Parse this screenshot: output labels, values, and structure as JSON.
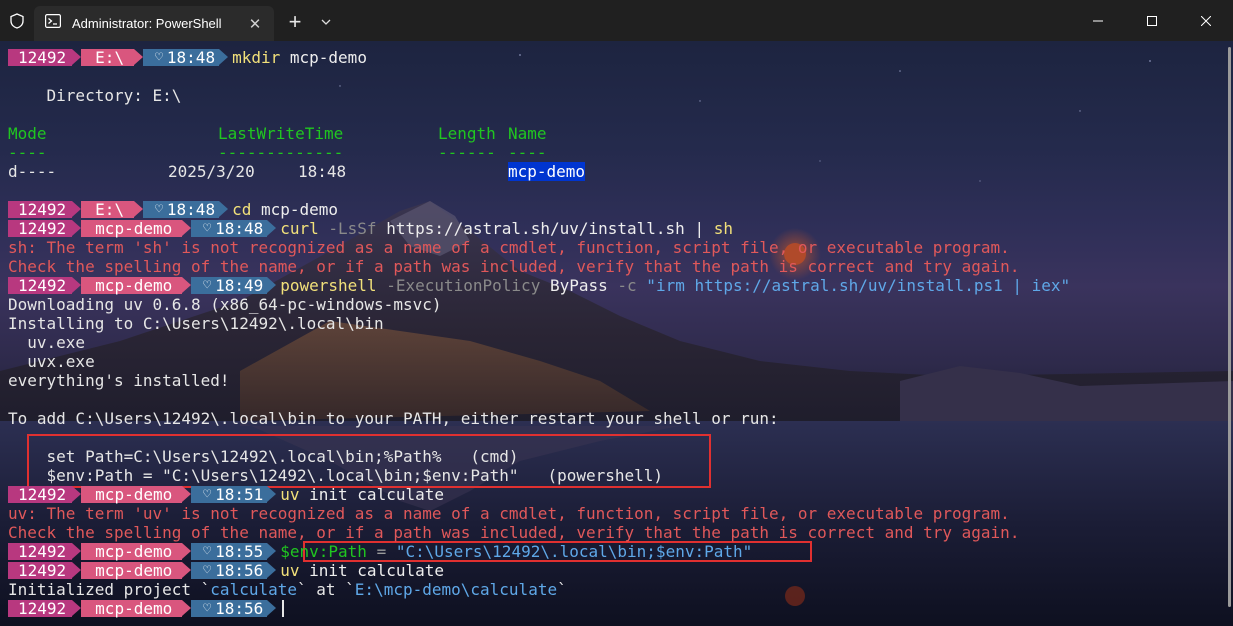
{
  "window": {
    "tab_title": "Administrator: PowerShell",
    "tab_close": "✕",
    "new_tab": "+",
    "dropdown": "⌄"
  },
  "prompt": {
    "id": "12492",
    "heart": "♡"
  },
  "lines": {
    "l1": {
      "dir": "E:\\",
      "time": "18:48",
      "cmd": "mkdir",
      "args": " mcp-demo"
    },
    "l3": "    Directory: E:\\",
    "l5_mode": "Mode",
    "l5_lwt": "LastWriteTime",
    "l5_len": "Length",
    "l5_name": "Name",
    "l6_mode": "----",
    "l6_lwt": "-------------",
    "l6_len": "------",
    "l6_name": "----",
    "l7_mode": "d----",
    "l7_date": "2025/3/20",
    "l7_time": "18:48",
    "l7_name": "mcp-demo",
    "l9": {
      "dir": "E:\\",
      "time": "18:48",
      "cmd": "cd",
      "args": " mcp-demo"
    },
    "l10": {
      "dir": "mcp-demo",
      "time": "18:48",
      "cmd": "curl",
      "param": " -LsSf",
      "args": " https://astral.sh/uv/install.sh | ",
      "cmd2": "sh"
    },
    "l11": "sh: The term 'sh' is not recognized as a name of a cmdlet, function, script file, or executable program.",
    "l12": "Check the spelling of the name, or if a path was included, verify that the path is correct and try again.",
    "l13": {
      "dir": "mcp-demo",
      "time": "18:49",
      "cmd": "powershell",
      "param": " -ExecutionPolicy",
      "arg": " ByPass",
      "param2": " -c",
      "str": " \"irm https://astral.sh/uv/install.ps1 | iex\""
    },
    "l14": "Downloading uv 0.6.8 (x86_64-pc-windows-msvc)",
    "l15": "Installing to C:\\Users\\12492\\.local\\bin",
    "l16": "  uv.exe",
    "l17": "  uvx.exe",
    "l18": "everything's installed!",
    "l20": "To add C:\\Users\\12492\\.local\\bin to your PATH, either restart your shell or run:",
    "l22": "    set Path=C:\\Users\\12492\\.local\\bin;%Path%   (cmd)",
    "l23": "    $env:Path = \"C:\\Users\\12492\\.local\\bin;$env:Path\"   (powershell)",
    "l24": {
      "dir": "mcp-demo",
      "time": "18:51",
      "cmd": "uv",
      "args": " init calculate"
    },
    "l25": "uv: The term 'uv' is not recognized as a name of a cmdlet, function, script file, or executable program.",
    "l26": "Check the spelling of the name, or if a path was included, verify that the path is correct and try again.",
    "l27": {
      "dir": "mcp-demo",
      "time": "18:55",
      "var": "$env:Path",
      "op": " = ",
      "str": "\"C:\\Users\\12492\\.local\\bin;$env:Path\""
    },
    "l28": {
      "dir": "mcp-demo",
      "time": "18:56",
      "cmd": "uv",
      "args": " init calculate"
    },
    "l29_a": "Initialized project `",
    "l29_b": "calculate",
    "l29_c": "` at `",
    "l29_d": "E:\\mcp-demo\\calculate",
    "l29_e": "`",
    "l30": {
      "dir": "mcp-demo",
      "time": "18:56"
    }
  }
}
